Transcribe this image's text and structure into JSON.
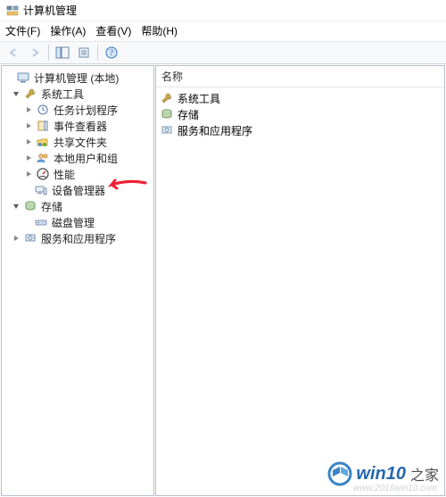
{
  "window": {
    "title": "计算机管理"
  },
  "menu": {
    "file": "文件(F)",
    "action": "操作(A)",
    "view": "查看(V)",
    "help": "帮助(H)"
  },
  "left": {
    "root": "计算机管理 (本地)",
    "group1": "系统工具",
    "items1": {
      "task": "任务计划程序",
      "event": "事件查看器",
      "shared": "共享文件夹",
      "users": "本地用户和组",
      "perf": "性能",
      "devmgr": "设备管理器"
    },
    "group2": "存储",
    "items2": {
      "disk": "磁盘管理"
    },
    "group3": "服务和应用程序"
  },
  "right": {
    "header": "名称",
    "items": {
      "a": "系统工具",
      "b": "存储",
      "c": "服务和应用程序"
    }
  },
  "watermark": {
    "brand1": "win10",
    "brand2": "之家",
    "url": "www.2016win10.com"
  }
}
